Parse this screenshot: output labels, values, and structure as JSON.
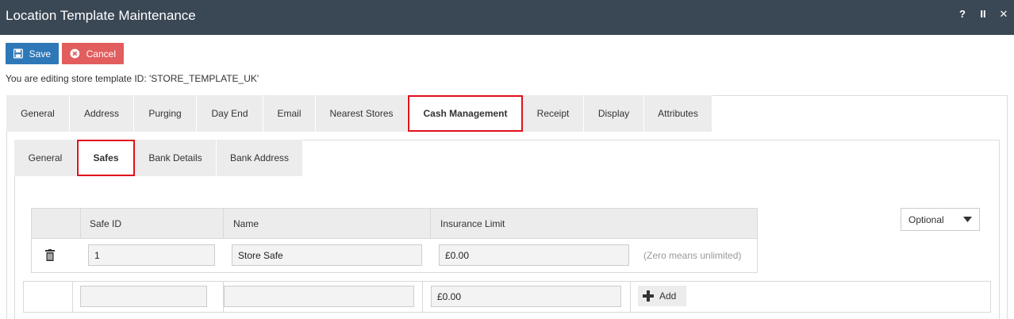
{
  "window": {
    "title": "Location Template Maintenance",
    "help": "?",
    "pause": "II",
    "close": "✕"
  },
  "toolbar": {
    "save_label": "Save",
    "cancel_label": "Cancel"
  },
  "editing_text": "You are editing store template ID: 'STORE_TEMPLATE_UK'",
  "tabs": [
    {
      "label": "General"
    },
    {
      "label": "Address"
    },
    {
      "label": "Purging"
    },
    {
      "label": "Day End"
    },
    {
      "label": "Email"
    },
    {
      "label": "Nearest Stores"
    },
    {
      "label": "Cash Management",
      "active": true
    },
    {
      "label": "Receipt"
    },
    {
      "label": "Display"
    },
    {
      "label": "Attributes"
    }
  ],
  "subtabs": [
    {
      "label": "General"
    },
    {
      "label": "Safes",
      "active": true
    },
    {
      "label": "Bank Details"
    },
    {
      "label": "Bank Address"
    }
  ],
  "grid": {
    "headers": [
      "Safe ID",
      "Name",
      "Insurance Limit"
    ],
    "rows": [
      {
        "safe_id": "1",
        "name": "Store Safe",
        "insurance_limit": "£0.00",
        "hint": "(Zero means unlimited)"
      }
    ]
  },
  "optional_select": {
    "value": "Optional"
  },
  "new_row": {
    "safe_id": "",
    "name": "",
    "insurance_limit": "£0.00",
    "add_label": "Add"
  },
  "colors": {
    "titlebar": "#3a4755",
    "save": "#2e78b8",
    "cancel": "#e25d5e",
    "active_tab_border": "#e0101c"
  }
}
